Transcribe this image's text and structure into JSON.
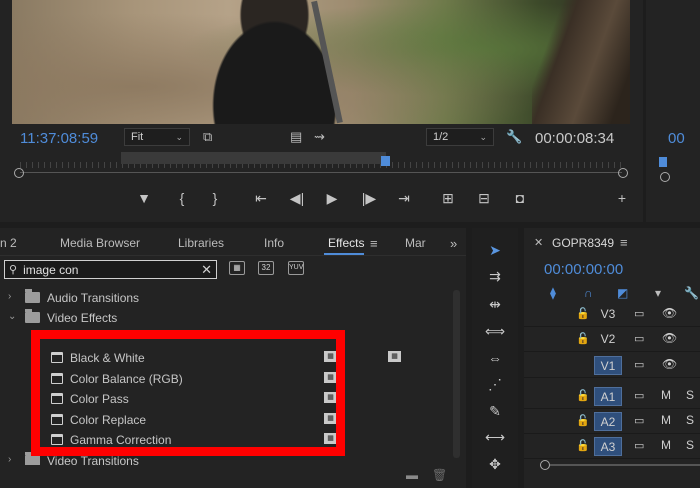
{
  "monitor": {
    "timecode_in": "11:37:08:59",
    "zoom": "Fit",
    "resolution": "1/2",
    "timecode_out": "00:00:08:34",
    "playhead_position": 0.6
  },
  "right_panel": {
    "timecode": "00"
  },
  "effects_panel": {
    "tabs": [
      "n 2",
      "Media Browser",
      "Libraries",
      "Info",
      "Effects",
      "Mar"
    ],
    "active_tab": "Effects",
    "search": {
      "value": "image con"
    },
    "filter_buttons": [
      "32",
      "YUV"
    ],
    "tree": [
      {
        "label": "Audio Transitions",
        "type": "folder",
        "expanded": false
      },
      {
        "label": "Video Effects",
        "type": "folder",
        "expanded": true
      },
      {
        "label": "Black & White",
        "type": "effect"
      },
      {
        "label": "Color Balance (RGB)",
        "type": "effect"
      },
      {
        "label": "Color Pass",
        "type": "effect"
      },
      {
        "label": "Color Replace",
        "type": "effect"
      },
      {
        "label": "Gamma Correction",
        "type": "effect"
      },
      {
        "label": "Video Transitions",
        "type": "folder",
        "expanded": false
      }
    ],
    "highlight_color": "#ff0000"
  },
  "timeline": {
    "sequence_name": "GOPR8349",
    "timecode": "00:00:00:00",
    "tracks": [
      {
        "name": "V3",
        "type": "video",
        "selected": false
      },
      {
        "name": "V2",
        "type": "video",
        "selected": false
      },
      {
        "name": "V1",
        "type": "video",
        "selected": true
      },
      {
        "name": "A1",
        "type": "audio",
        "selected": true,
        "m": "M",
        "s": "S"
      },
      {
        "name": "A2",
        "type": "audio",
        "selected": true,
        "m": "M",
        "s": "S"
      },
      {
        "name": "A3",
        "type": "audio",
        "selected": true,
        "m": "M",
        "s": "S"
      }
    ]
  },
  "colors": {
    "accent": "#4f8cd9",
    "background": "#232323",
    "highlight": "#ff0000"
  }
}
